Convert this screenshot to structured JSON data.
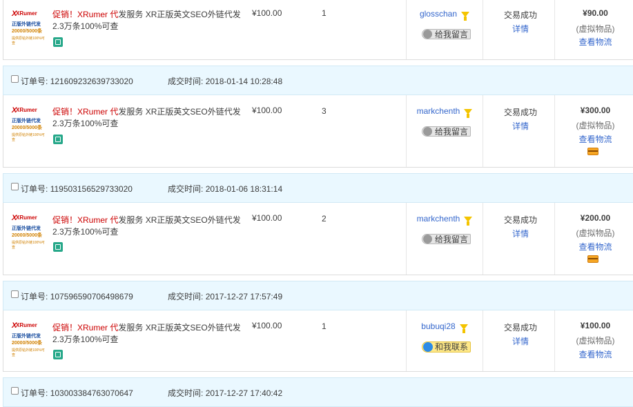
{
  "labels": {
    "order_no": "订单号:",
    "deal_time": "成交时间:",
    "leave_message": "给我留言",
    "contact_me": "和我联系",
    "status": "交易成功",
    "detail": "详情",
    "virtual_goods": "(虚拟物品)",
    "view_logistics": "查看物流"
  },
  "product": {
    "title_promo": "促销！XRumer 代",
    "title_rest": "发服务 XR正版英文SEO外链代发2.3万条100%可查",
    "thumb_logo": "XRumer",
    "thumb_line1": "正版外链代发",
    "thumb_line2": "20000/5000条",
    "thumb_line3": "提供原帖外链100%可查"
  },
  "orders": [
    {
      "order_no": "",
      "deal_time": "",
      "price": "¥100.00",
      "qty": "1",
      "buyer": "glosschan",
      "amount": "¥90.00",
      "contact": "message"
    },
    {
      "order_no": "121609232639733020",
      "deal_time": "2018-01-14 10:28:48",
      "price": "¥100.00",
      "qty": "3",
      "buyer": "markchenth",
      "amount": "¥300.00",
      "contact": "message"
    },
    {
      "order_no": "119503156529733020",
      "deal_time": "2018-01-06 18:31:14",
      "price": "¥100.00",
      "qty": "2",
      "buyer": "markchenth",
      "amount": "¥200.00",
      "contact": "message"
    },
    {
      "order_no": "107596590706498679",
      "deal_time": "2017-12-27 17:57:49",
      "price": "¥100.00",
      "qty": "1",
      "buyer": "bubuqi28",
      "amount": "¥100.00",
      "contact": "contact"
    },
    {
      "order_no": "103003384763070647",
      "deal_time": "2017-12-27 17:40:42"
    }
  ],
  "colors": {
    "header_bg": "#eaf8ff",
    "link": "#3366cc",
    "promo": "#cc0000"
  }
}
